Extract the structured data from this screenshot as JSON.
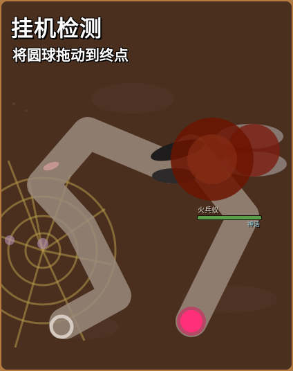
{
  "title": "挂机检测",
  "instruction": "将圆球拖动到终点",
  "enemy": {
    "name": "火兵蚁",
    "level_label": "神话",
    "health_fraction": 1.0
  },
  "colors": {
    "background": "#4a2f1f",
    "path": "#9a8a7c",
    "ball": "#ff2f78",
    "ball_ring": "#d81b60",
    "goal_ring": "#e8e0d8",
    "web": "#b79a4a",
    "enemy_glow": "#6b1400",
    "health": "#5aa04a"
  }
}
